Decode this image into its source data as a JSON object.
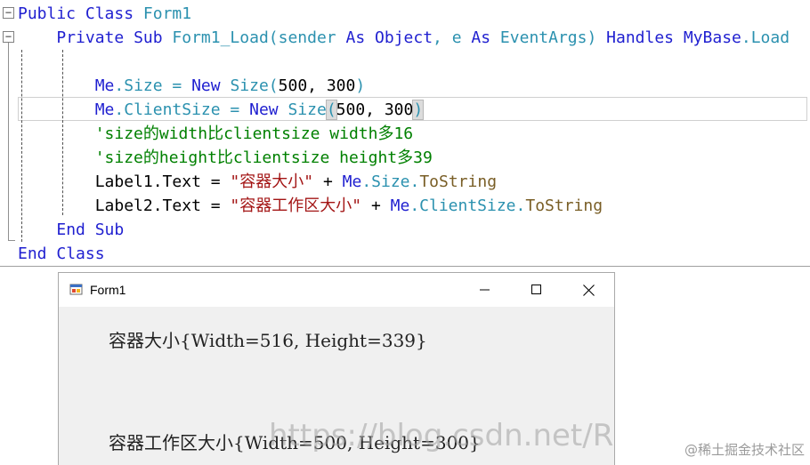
{
  "editor": {
    "lines": [
      [
        {
          "t": "Public",
          "c": "kw"
        },
        {
          "t": " ",
          "c": "pl"
        },
        {
          "t": "Class",
          "c": "kw"
        },
        {
          "t": " Form1",
          "c": "tp"
        }
      ],
      [
        {
          "t": "    ",
          "c": "pl"
        },
        {
          "t": "Private",
          "c": "kw"
        },
        {
          "t": " ",
          "c": "pl"
        },
        {
          "t": "Sub",
          "c": "kw"
        },
        {
          "t": " Form1_Load(sender ",
          "c": "tp"
        },
        {
          "t": "As",
          "c": "kw"
        },
        {
          "t": " ",
          "c": "pl"
        },
        {
          "t": "Object",
          "c": "kw"
        },
        {
          "t": ", e ",
          "c": "tp"
        },
        {
          "t": "As",
          "c": "kw"
        },
        {
          "t": " EventArgs) ",
          "c": "tp"
        },
        {
          "t": "Handles",
          "c": "kw"
        },
        {
          "t": " ",
          "c": "pl"
        },
        {
          "t": "MyBase",
          "c": "kw"
        },
        {
          "t": ".Load",
          "c": "tp"
        }
      ],
      [
        {
          "t": "",
          "c": "pl"
        }
      ],
      [
        {
          "t": "        ",
          "c": "pl"
        },
        {
          "t": "Me",
          "c": "kw"
        },
        {
          "t": ".Size = ",
          "c": "tp"
        },
        {
          "t": "New",
          "c": "kw"
        },
        {
          "t": " Size(",
          "c": "tp"
        },
        {
          "t": "500, 300",
          "c": "pl"
        },
        {
          "t": ")",
          "c": "tp"
        }
      ],
      [
        {
          "t": "        ",
          "c": "pl"
        },
        {
          "t": "Me",
          "c": "kw"
        },
        {
          "t": ".ClientSize = ",
          "c": "tp"
        },
        {
          "t": "New",
          "c": "kw"
        },
        {
          "t": " Size",
          "c": "tp"
        },
        {
          "t": "(",
          "c": "tp",
          "hl": true
        },
        {
          "t": "500, 300",
          "c": "pl"
        },
        {
          "t": ")",
          "c": "tp",
          "hl": true
        }
      ],
      [
        {
          "t": "        ",
          "c": "pl"
        },
        {
          "t": "'size的width比clientsize width多16",
          "c": "cm"
        }
      ],
      [
        {
          "t": "        ",
          "c": "pl"
        },
        {
          "t": "'size的height比clientsize height多39",
          "c": "cm"
        }
      ],
      [
        {
          "t": "        Label1.Text = ",
          "c": "pl"
        },
        {
          "t": "\"容器大小\"",
          "c": "st"
        },
        {
          "t": " + ",
          "c": "pl"
        },
        {
          "t": "Me",
          "c": "kw"
        },
        {
          "t": ".Size.",
          "c": "tp"
        },
        {
          "t": "ToString",
          "c": "mt"
        }
      ],
      [
        {
          "t": "        Label2.Text = ",
          "c": "pl"
        },
        {
          "t": "\"容器工作区大小\"",
          "c": "st"
        },
        {
          "t": " + ",
          "c": "pl"
        },
        {
          "t": "Me",
          "c": "kw"
        },
        {
          "t": ".ClientSize.",
          "c": "tp"
        },
        {
          "t": "ToString",
          "c": "mt"
        }
      ],
      [
        {
          "t": "    ",
          "c": "pl"
        },
        {
          "t": "End",
          "c": "kw"
        },
        {
          "t": " ",
          "c": "pl"
        },
        {
          "t": "Sub",
          "c": "kw"
        }
      ],
      [
        {
          "t": "End",
          "c": "kw"
        },
        {
          "t": " ",
          "c": "pl"
        },
        {
          "t": "Class",
          "c": "kw"
        }
      ]
    ],
    "collapse_glyph": "−"
  },
  "form_window": {
    "title": "Form1",
    "icons": {
      "app": "winforms-app-icon",
      "minimize": "minimize-icon",
      "maximize": "maximize-icon",
      "close": "close-icon"
    },
    "label1": "容器大小{Width=516, Height=339}",
    "label2": "容器工作区大小{Width=500, Height=300}"
  },
  "watermarks": {
    "url": "https://blog.csdn.net/R",
    "site": "@稀土掘金技术社区"
  },
  "colors": {
    "keyword": "#1f1fd0",
    "identifier": "#2b91af",
    "comment": "#008000",
    "string": "#a31515",
    "method": "#795e26",
    "form_background": "#f0f0f0"
  }
}
